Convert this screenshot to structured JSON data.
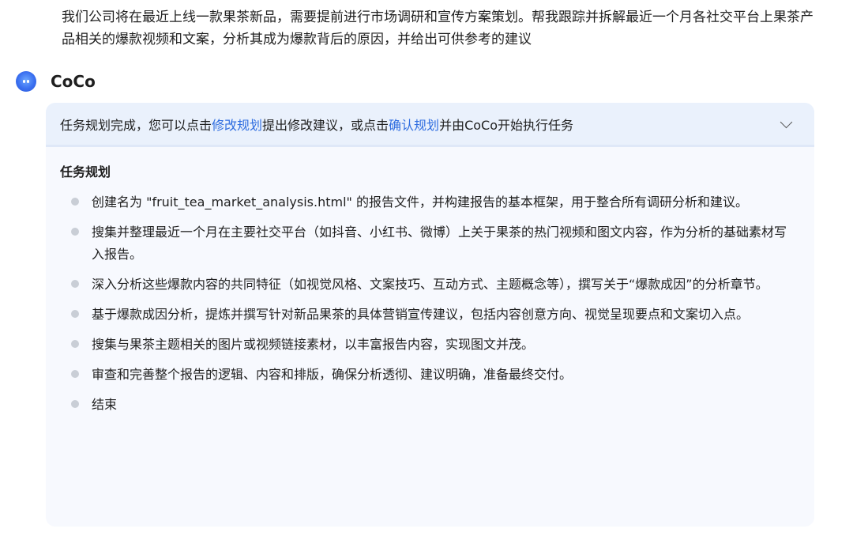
{
  "user_message": "我们公司将在最近上线一款果茶新品，需要提前进行市场调研和宣传方案策划。帮我跟踪并拆解最近一个月各社交平台上果茶产品相关的爆款视频和文案，分析其成为爆款背后的原因，并给出可供参考的建议",
  "assistant": {
    "name": "CoCo",
    "avatar_icon": "coco-avatar-icon"
  },
  "plan": {
    "header_prefix": "任务规划完成，您可以点击",
    "edit_link": "修改规划",
    "header_middle": "提出修改建议，或点击",
    "confirm_link": "确认规划",
    "header_suffix": "并由CoCo开始执行任务",
    "title": "任务规划",
    "steps": [
      "创建名为 \"fruit_tea_market_analysis.html\" 的报告文件，并构建报告的基本框架，用于整合所有调研分析和建议。",
      "搜集并整理最近一个月在主要社交平台（如抖音、小红书、微博）上关于果茶的热门视频和图文内容，作为分析的基础素材写入报告。",
      "深入分析这些爆款内容的共同特征（如视觉风格、文案技巧、互动方式、主题概念等），撰写关于“爆款成因”的分析章节。",
      "基于爆款成因分析，提炼并撰写针对新品果茶的具体营销宣传建议，包括内容创意方向、视觉呈现要点和文案切入点。",
      "搜集与果茶主题相关的图片或视频链接素材，以丰富报告内容，实现图文并茂。",
      "审查和完善整个报告的逻辑、内容和排版，确保分析透彻、建议明确，准备最终交付。",
      "结束"
    ]
  },
  "colors": {
    "link": "#2f6de0",
    "card_bg": "#f7f9fe",
    "header_bg": "#eaf1fc",
    "bullet": "#c9ced6"
  }
}
